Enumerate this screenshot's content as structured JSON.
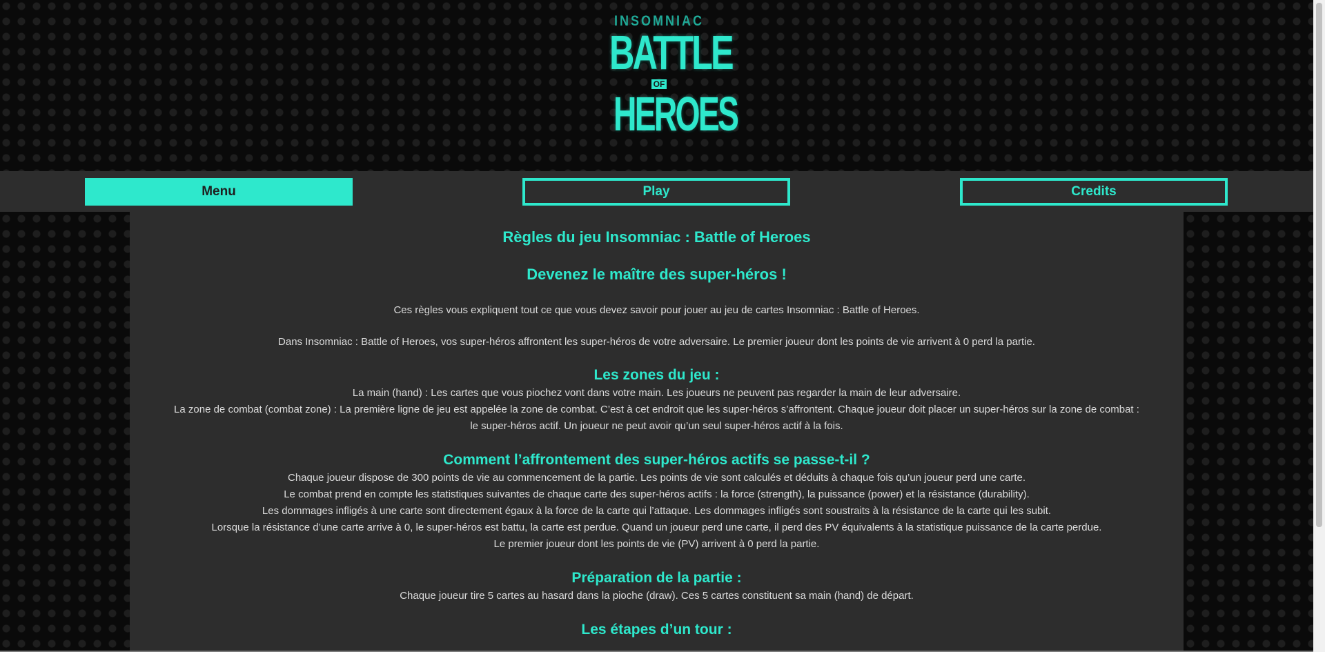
{
  "logo": {
    "top_text": "INSOMNIAC",
    "line1": "BATTLE",
    "of": "OF",
    "line2": "HEROES"
  },
  "nav": {
    "items": [
      {
        "label": "Menu",
        "active": true
      },
      {
        "label": "Play",
        "active": false
      },
      {
        "label": "Credits",
        "active": false
      }
    ]
  },
  "content": {
    "title": "Règles du jeu Insomniac : Battle of Heroes",
    "subtitle": "Devenez le maître des super-héros !",
    "intro1": "Ces règles vous expliquent tout ce que vous devez savoir pour jouer au jeu de cartes Insomniac : Battle of Heroes.",
    "intro2": "Dans Insomniac : Battle of Heroes, vos super-héros affrontent les super-héros de votre adversaire. Le premier joueur dont les points de vie arrivent à 0 perd la partie.",
    "zones": {
      "heading": "Les zones du jeu :",
      "lines": [
        "La main (hand) : Les cartes que vous piochez vont dans votre main. Les joueurs ne peuvent pas regarder la main de leur adversaire.",
        "La zone de combat (combat zone) : La première ligne de jeu est appelée la zone de combat. C’est à cet endroit que les super-héros s’affrontent. Chaque joueur doit placer un super-héros sur la zone de combat : le super-héros actif. Un joueur ne peut avoir qu’un seul super-héros actif à la fois."
      ]
    },
    "combat": {
      "heading": "Comment l’affrontement des super-héros actifs se passe-t-il ?",
      "lines": [
        "Chaque joueur dispose de 300 points de vie au commencement de la partie. Les points de vie sont calculés et déduits à chaque fois qu’un joueur perd une carte.",
        "Le combat prend en compte les statistiques suivantes de chaque carte des super-héros actifs : la force (strength), la puissance (power) et la résistance (durability).",
        "Les dommages infligés à une carte sont directement égaux à la force de la carte qui l’attaque. Les dommages infligés sont soustraits à la résistance de la carte qui les subit.",
        "Lorsque la résistance d’une carte arrive à 0, le super-héros est battu, la carte est perdue. Quand un joueur perd une carte, il perd des PV équivalents à la statistique puissance de la carte perdue.",
        "Le premier joueur dont les points de vie (PV) arrivent à 0 perd la partie."
      ]
    },
    "preparation": {
      "heading": "Préparation de la partie :",
      "lines": [
        "Chaque joueur tire 5 cartes au hasard dans la pioche (draw). Ces 5 cartes constituent sa main (hand) de départ."
      ]
    },
    "next_heading": "Les étapes d’un tour :"
  },
  "colors": {
    "accent": "#2ee8cc",
    "panel": "#2d2d2d",
    "background": "#0a0a0a"
  }
}
